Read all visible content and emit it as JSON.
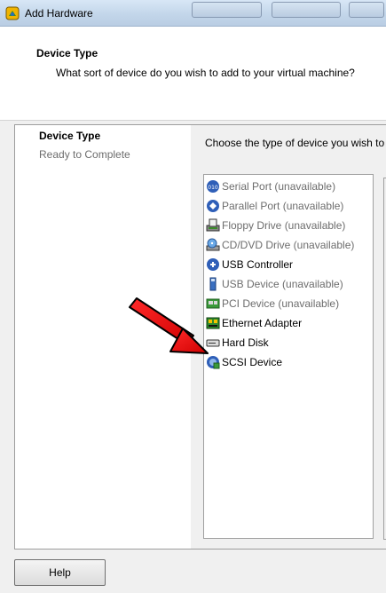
{
  "window": {
    "title": "Add Hardware"
  },
  "header": {
    "title": "Device Type",
    "subtitle": "What sort of device do you wish to add to your virtual machine?"
  },
  "steps": {
    "active": "Device Type",
    "next": "Ready to Complete"
  },
  "content": {
    "prompt": "Choose the type of device you wish to add."
  },
  "devices": [
    {
      "label": "Serial Port (unavailable)",
      "icon": "serial-port-icon",
      "available": false
    },
    {
      "label": "Parallel Port (unavailable)",
      "icon": "parallel-port-icon",
      "available": false
    },
    {
      "label": "Floppy Drive (unavailable)",
      "icon": "floppy-drive-icon",
      "available": false
    },
    {
      "label": "CD/DVD Drive (unavailable)",
      "icon": "cd-dvd-drive-icon",
      "available": false
    },
    {
      "label": "USB Controller",
      "icon": "usb-controller-icon",
      "available": true
    },
    {
      "label": "USB Device (unavailable)",
      "icon": "usb-device-icon",
      "available": false
    },
    {
      "label": "PCI Device (unavailable)",
      "icon": "pci-device-icon",
      "available": false
    },
    {
      "label": "Ethernet Adapter",
      "icon": "ethernet-adapter-icon",
      "available": true
    },
    {
      "label": "Hard Disk",
      "icon": "hard-disk-icon",
      "available": true
    },
    {
      "label": "SCSI Device",
      "icon": "scsi-device-icon",
      "available": true
    }
  ],
  "footer": {
    "help_label": "Help"
  },
  "colors": {
    "arrow": "#e00000",
    "unavailable_text": "#6d6d6d"
  }
}
